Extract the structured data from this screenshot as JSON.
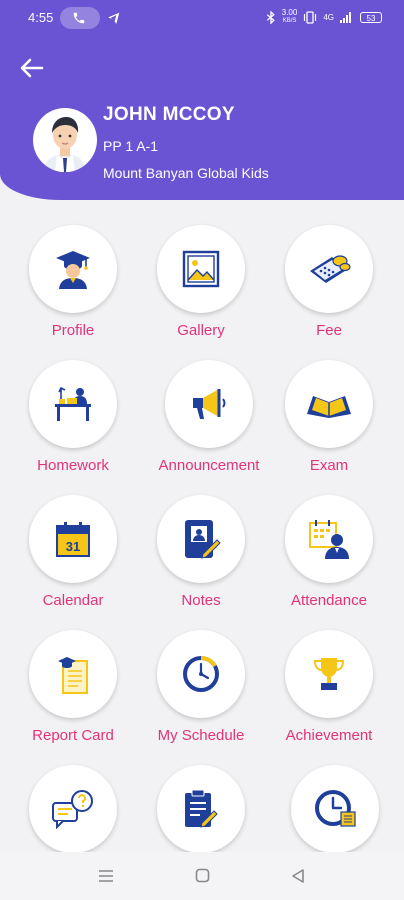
{
  "status_bar": {
    "time": "4:55",
    "speed_value": "3.00",
    "speed_unit": "KB/S",
    "network": "4G",
    "battery": "53"
  },
  "header": {
    "student_name": "JOHN MCCOY",
    "class": "PP 1 A-1",
    "school": "Mount Banyan Global Kids"
  },
  "menu": {
    "profile": "Profile",
    "gallery": "Gallery",
    "fee": "Fee",
    "homework": "Homework",
    "announcement": "Announcement",
    "exam": "Exam",
    "calendar": "Calendar",
    "notes": "Notes",
    "attendance": "Attendance",
    "report_card": "Report Card",
    "my_schedule": "My Schedule",
    "achievement": "Achievement",
    "calendar_date": "31"
  },
  "colors": {
    "header_bg": "#6b54d3",
    "label_pink": "#e2337a",
    "icon_blue": "#1f3f9b",
    "icon_yellow": "#f5c518"
  }
}
